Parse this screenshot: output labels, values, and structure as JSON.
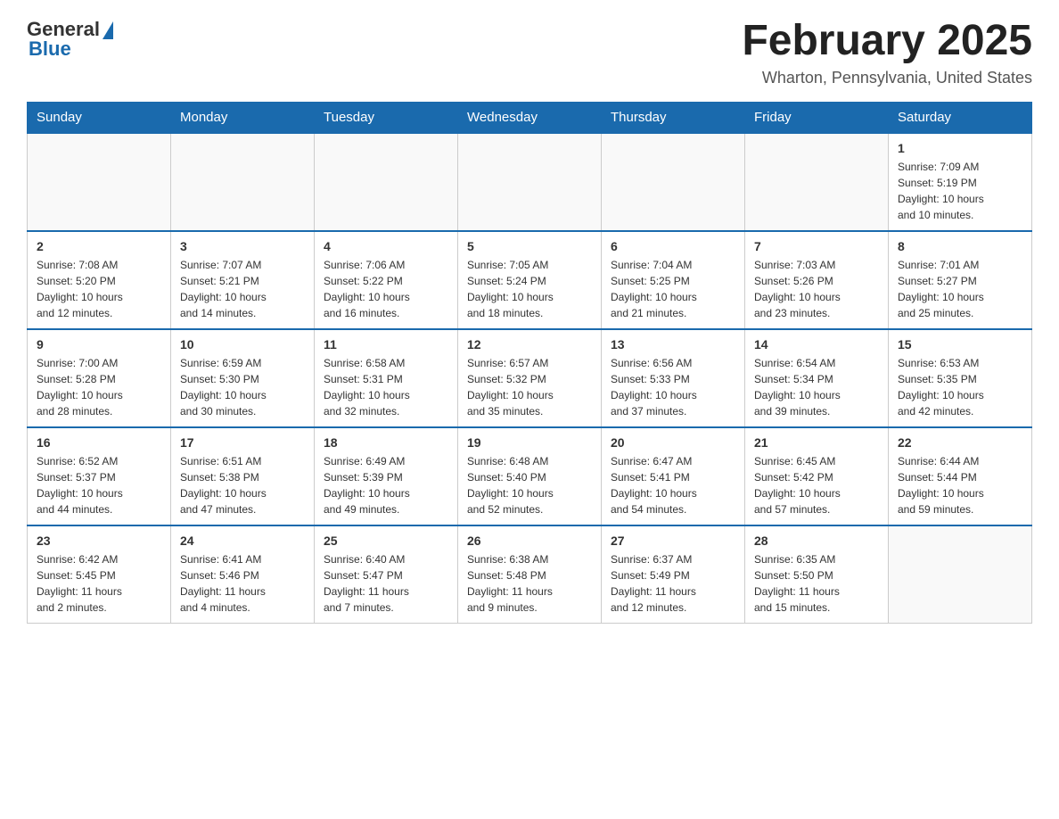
{
  "header": {
    "logo_general": "General",
    "logo_blue": "Blue",
    "month_title": "February 2025",
    "location": "Wharton, Pennsylvania, United States"
  },
  "weekdays": [
    "Sunday",
    "Monday",
    "Tuesday",
    "Wednesday",
    "Thursday",
    "Friday",
    "Saturday"
  ],
  "weeks": [
    [
      {
        "day": "",
        "info": ""
      },
      {
        "day": "",
        "info": ""
      },
      {
        "day": "",
        "info": ""
      },
      {
        "day": "",
        "info": ""
      },
      {
        "day": "",
        "info": ""
      },
      {
        "day": "",
        "info": ""
      },
      {
        "day": "1",
        "info": "Sunrise: 7:09 AM\nSunset: 5:19 PM\nDaylight: 10 hours\nand 10 minutes."
      }
    ],
    [
      {
        "day": "2",
        "info": "Sunrise: 7:08 AM\nSunset: 5:20 PM\nDaylight: 10 hours\nand 12 minutes."
      },
      {
        "day": "3",
        "info": "Sunrise: 7:07 AM\nSunset: 5:21 PM\nDaylight: 10 hours\nand 14 minutes."
      },
      {
        "day": "4",
        "info": "Sunrise: 7:06 AM\nSunset: 5:22 PM\nDaylight: 10 hours\nand 16 minutes."
      },
      {
        "day": "5",
        "info": "Sunrise: 7:05 AM\nSunset: 5:24 PM\nDaylight: 10 hours\nand 18 minutes."
      },
      {
        "day": "6",
        "info": "Sunrise: 7:04 AM\nSunset: 5:25 PM\nDaylight: 10 hours\nand 21 minutes."
      },
      {
        "day": "7",
        "info": "Sunrise: 7:03 AM\nSunset: 5:26 PM\nDaylight: 10 hours\nand 23 minutes."
      },
      {
        "day": "8",
        "info": "Sunrise: 7:01 AM\nSunset: 5:27 PM\nDaylight: 10 hours\nand 25 minutes."
      }
    ],
    [
      {
        "day": "9",
        "info": "Sunrise: 7:00 AM\nSunset: 5:28 PM\nDaylight: 10 hours\nand 28 minutes."
      },
      {
        "day": "10",
        "info": "Sunrise: 6:59 AM\nSunset: 5:30 PM\nDaylight: 10 hours\nand 30 minutes."
      },
      {
        "day": "11",
        "info": "Sunrise: 6:58 AM\nSunset: 5:31 PM\nDaylight: 10 hours\nand 32 minutes."
      },
      {
        "day": "12",
        "info": "Sunrise: 6:57 AM\nSunset: 5:32 PM\nDaylight: 10 hours\nand 35 minutes."
      },
      {
        "day": "13",
        "info": "Sunrise: 6:56 AM\nSunset: 5:33 PM\nDaylight: 10 hours\nand 37 minutes."
      },
      {
        "day": "14",
        "info": "Sunrise: 6:54 AM\nSunset: 5:34 PM\nDaylight: 10 hours\nand 39 minutes."
      },
      {
        "day": "15",
        "info": "Sunrise: 6:53 AM\nSunset: 5:35 PM\nDaylight: 10 hours\nand 42 minutes."
      }
    ],
    [
      {
        "day": "16",
        "info": "Sunrise: 6:52 AM\nSunset: 5:37 PM\nDaylight: 10 hours\nand 44 minutes."
      },
      {
        "day": "17",
        "info": "Sunrise: 6:51 AM\nSunset: 5:38 PM\nDaylight: 10 hours\nand 47 minutes."
      },
      {
        "day": "18",
        "info": "Sunrise: 6:49 AM\nSunset: 5:39 PM\nDaylight: 10 hours\nand 49 minutes."
      },
      {
        "day": "19",
        "info": "Sunrise: 6:48 AM\nSunset: 5:40 PM\nDaylight: 10 hours\nand 52 minutes."
      },
      {
        "day": "20",
        "info": "Sunrise: 6:47 AM\nSunset: 5:41 PM\nDaylight: 10 hours\nand 54 minutes."
      },
      {
        "day": "21",
        "info": "Sunrise: 6:45 AM\nSunset: 5:42 PM\nDaylight: 10 hours\nand 57 minutes."
      },
      {
        "day": "22",
        "info": "Sunrise: 6:44 AM\nSunset: 5:44 PM\nDaylight: 10 hours\nand 59 minutes."
      }
    ],
    [
      {
        "day": "23",
        "info": "Sunrise: 6:42 AM\nSunset: 5:45 PM\nDaylight: 11 hours\nand 2 minutes."
      },
      {
        "day": "24",
        "info": "Sunrise: 6:41 AM\nSunset: 5:46 PM\nDaylight: 11 hours\nand 4 minutes."
      },
      {
        "day": "25",
        "info": "Sunrise: 6:40 AM\nSunset: 5:47 PM\nDaylight: 11 hours\nand 7 minutes."
      },
      {
        "day": "26",
        "info": "Sunrise: 6:38 AM\nSunset: 5:48 PM\nDaylight: 11 hours\nand 9 minutes."
      },
      {
        "day": "27",
        "info": "Sunrise: 6:37 AM\nSunset: 5:49 PM\nDaylight: 11 hours\nand 12 minutes."
      },
      {
        "day": "28",
        "info": "Sunrise: 6:35 AM\nSunset: 5:50 PM\nDaylight: 11 hours\nand 15 minutes."
      },
      {
        "day": "",
        "info": ""
      }
    ]
  ]
}
